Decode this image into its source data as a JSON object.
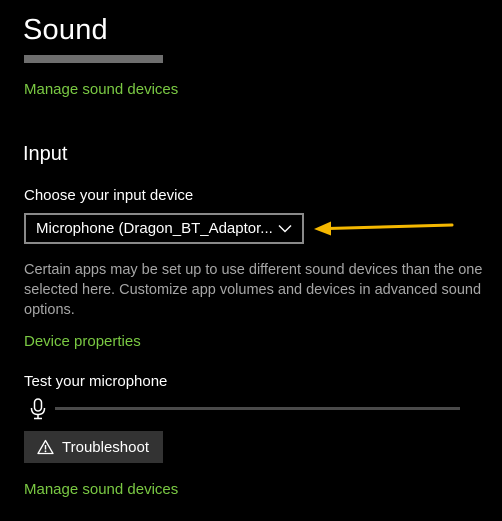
{
  "header": {
    "title": "Sound"
  },
  "output": {
    "manage_link": "Manage sound devices"
  },
  "input": {
    "section_title": "Input",
    "choose_label": "Choose your input device",
    "selected_device": "Microphone (Dragon_BT_Adaptor...",
    "description": "Certain apps may be set up to use different sound devices than the one selected here. Customize app volumes and devices in advanced sound options.",
    "device_properties_link": "Device properties",
    "test_label": "Test your microphone",
    "mic_level": 0,
    "troubleshoot_label": "Troubleshoot",
    "manage_link": "Manage sound devices"
  },
  "colors": {
    "accent": "#7ac943",
    "background": "#000000",
    "annotation_arrow": "#f5b800"
  },
  "icons": [
    "chevron-down-icon",
    "microphone-icon",
    "warning-icon",
    "arrow-annotation"
  ]
}
